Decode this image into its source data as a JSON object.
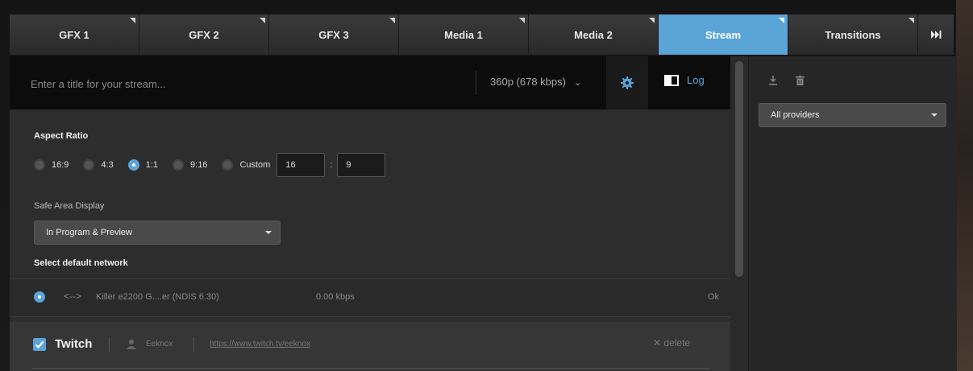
{
  "tabs": [
    {
      "label": "GFX 1"
    },
    {
      "label": "GFX 2"
    },
    {
      "label": "GFX 3"
    },
    {
      "label": "Media 1"
    },
    {
      "label": "Media 2"
    },
    {
      "label": "Stream",
      "active": true
    },
    {
      "label": "Transitions"
    }
  ],
  "tab_overflow_icon": "skip-forward-icon",
  "stream": {
    "title_placeholder": "Enter a title for your stream...",
    "quality": "360p (678 kbps)",
    "log_label": "Log"
  },
  "aspect_ratio": {
    "label": "Aspect Ratio",
    "options": [
      "16:9",
      "4:3",
      "1:1",
      "9:16",
      "Custom"
    ],
    "selected": "1:1",
    "custom_width": "16",
    "custom_separator": ":",
    "custom_height": "9"
  },
  "safe_area": {
    "label": "Safe Area Display",
    "value": "In Program & Preview"
  },
  "network": {
    "label": "Select default network",
    "name": "Killer e2200 G....er (NDIS 6.30)",
    "rate": "0.00 kbps",
    "status": "Ok"
  },
  "provider": {
    "name": "Twitch",
    "username": "Eeknox",
    "url": "https://www.twitch.tv/eeknox",
    "delete_label": "delete"
  },
  "sidebar": {
    "filter_value": "All providers"
  },
  "colors": {
    "accent": "#5ba4d8",
    "bg": "#2d2d2d"
  }
}
